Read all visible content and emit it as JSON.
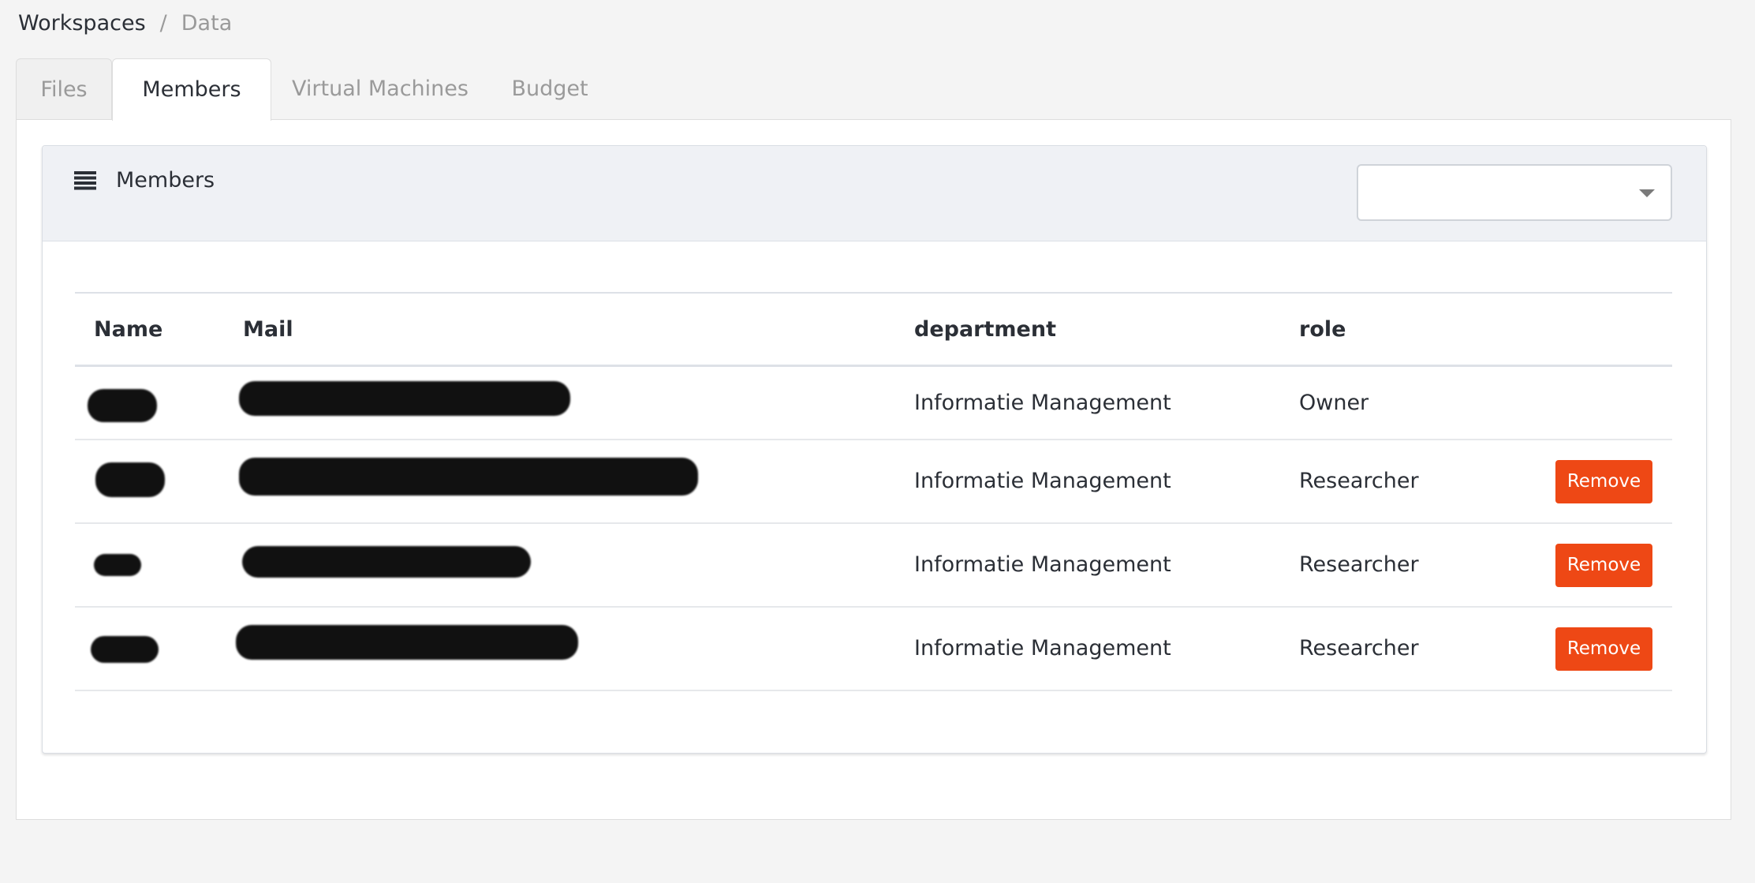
{
  "breadcrumb": {
    "root": "Workspaces",
    "separator": "/",
    "current": "Data"
  },
  "tabs": [
    {
      "label": "Files",
      "active": false
    },
    {
      "label": "Members",
      "active": true
    },
    {
      "label": "Virtual Machines",
      "active": false
    },
    {
      "label": "Budget",
      "active": false
    }
  ],
  "card": {
    "title": "Members",
    "icon": "list-icon",
    "select": {
      "value": ""
    }
  },
  "table": {
    "columns": [
      "Name",
      "Mail",
      "department",
      "role"
    ],
    "rows": [
      {
        "name": "",
        "mail": "",
        "department": "Informatie Management",
        "role": "Owner",
        "action": ""
      },
      {
        "name": "",
        "mail": "",
        "department": "Informatie Management",
        "role": "Researcher",
        "action": "Remove"
      },
      {
        "name": "",
        "mail": "",
        "department": "Informatie Management",
        "role": "Researcher",
        "action": "Remove"
      },
      {
        "name": "",
        "mail": "",
        "department": "Informatie Management",
        "role": "Researcher",
        "action": "Remove"
      }
    ]
  },
  "colors": {
    "accent_button": "#ee4815",
    "header_bg": "#eff1f5",
    "page_bg": "#f4f4f4"
  }
}
